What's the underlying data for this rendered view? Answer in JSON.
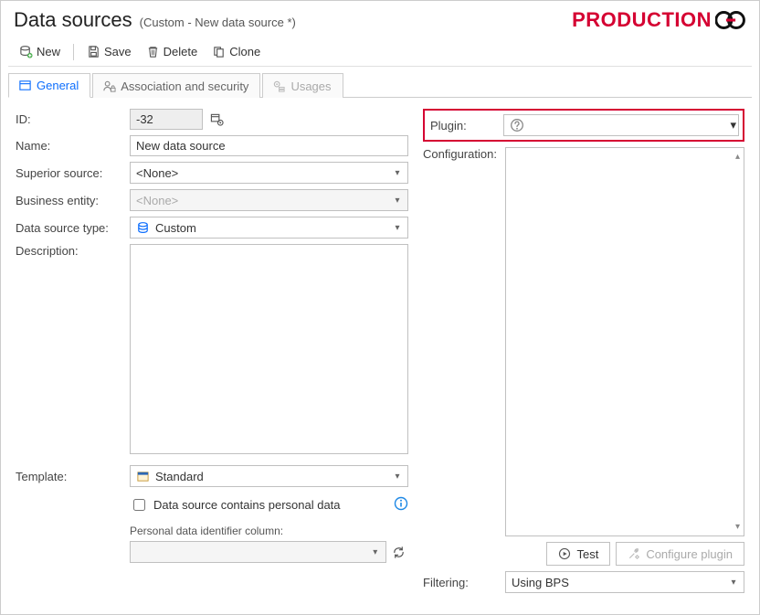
{
  "header": {
    "title": "Data sources",
    "subtitle": "(Custom - New data source *)",
    "env_badge": "PRODUCTION"
  },
  "toolbar": {
    "new": "New",
    "save": "Save",
    "delete": "Delete",
    "clone": "Clone"
  },
  "tabs": {
    "general": "General",
    "assoc": "Association and security",
    "usages": "Usages"
  },
  "form": {
    "id_label": "ID:",
    "id_value": "-32",
    "name_label": "Name:",
    "name_value": "New data source",
    "superior_label": "Superior source:",
    "superior_value": "<None>",
    "entity_label": "Business entity:",
    "entity_value": "<None>",
    "type_label": "Data source type:",
    "type_value": "Custom",
    "desc_label": "Description:",
    "desc_value": "",
    "template_label": "Template:",
    "template_value": "Standard",
    "personal_data_check": "Data source contains personal data",
    "personal_id_label": "Personal data identifier column:",
    "personal_id_value": ""
  },
  "right": {
    "plugin_label": "Plugin:",
    "plugin_value": "",
    "config_label": "Configuration:",
    "test_btn": "Test",
    "configure_btn": "Configure plugin",
    "filter_label": "Filtering:",
    "filter_value": "Using BPS"
  }
}
